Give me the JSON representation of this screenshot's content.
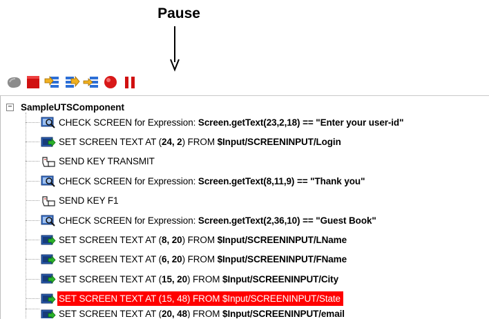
{
  "callout": {
    "label": "Pause"
  },
  "toolbar": {
    "buttons": [
      {
        "name": "record-off-icon"
      },
      {
        "name": "stop-icon"
      },
      {
        "name": "step-into-icon"
      },
      {
        "name": "step-over-icon"
      },
      {
        "name": "step-return-icon"
      },
      {
        "name": "record-icon"
      },
      {
        "name": "pause-icon"
      }
    ]
  },
  "tree": {
    "expander": "−",
    "root": "SampleUTSComponent",
    "rows": [
      {
        "icon": "check-screen-icon",
        "pre": "CHECK SCREEN for Expression: ",
        "bold": "Screen.getText(23,2,18) == \"Enter your user-id\"",
        "mid": "",
        "bold2": ""
      },
      {
        "icon": "set-text-icon",
        "pre": "SET SCREEN TEXT AT (",
        "bold": "24, 2",
        "mid": ") FROM ",
        "bold2": "$Input/SCREENINPUT/Login"
      },
      {
        "icon": "send-key-icon",
        "pre": "SEND KEY TRANSMIT",
        "bold": "",
        "mid": "",
        "bold2": ""
      },
      {
        "icon": "check-screen-icon",
        "pre": "CHECK SCREEN for Expression: ",
        "bold": "Screen.getText(8,11,9) == \"Thank you\"",
        "mid": "",
        "bold2": ""
      },
      {
        "icon": "send-key-icon",
        "pre": "SEND KEY F1",
        "bold": "",
        "mid": "",
        "bold2": ""
      },
      {
        "icon": "check-screen-icon",
        "pre": "CHECK SCREEN for Expression: ",
        "bold": "Screen.getText(2,36,10) == \"Guest Book\"",
        "mid": "",
        "bold2": ""
      },
      {
        "icon": "set-text-icon",
        "pre": "SET SCREEN TEXT AT (",
        "bold": "8, 20",
        "mid": ") FROM ",
        "bold2": "$Input/SCREENINPUT/LName"
      },
      {
        "icon": "set-text-icon",
        "pre": "SET SCREEN TEXT AT (",
        "bold": "6, 20",
        "mid": ") FROM ",
        "bold2": "$Input/SCREENINPUT/FName"
      },
      {
        "icon": "set-text-icon",
        "pre": "SET SCREEN TEXT AT (",
        "bold": "15, 20",
        "mid": ") FROM ",
        "bold2": "$Input/SCREENINPUT/City"
      },
      {
        "icon": "set-text-icon",
        "pre": "SET SCREEN TEXT AT (15, 48) FROM $Input/SCREENINPUT/State",
        "bold": "",
        "mid": "",
        "bold2": "",
        "selected": true
      },
      {
        "icon": "set-text-icon",
        "pre": "SET SCREEN TEXT AT (",
        "bold": "20, 48",
        "mid": ") FROM ",
        "bold2": "$Input/SCREENINPUT/email"
      }
    ]
  },
  "colors": {
    "selection": "#ff0000",
    "selection_text": "#ffffff"
  }
}
